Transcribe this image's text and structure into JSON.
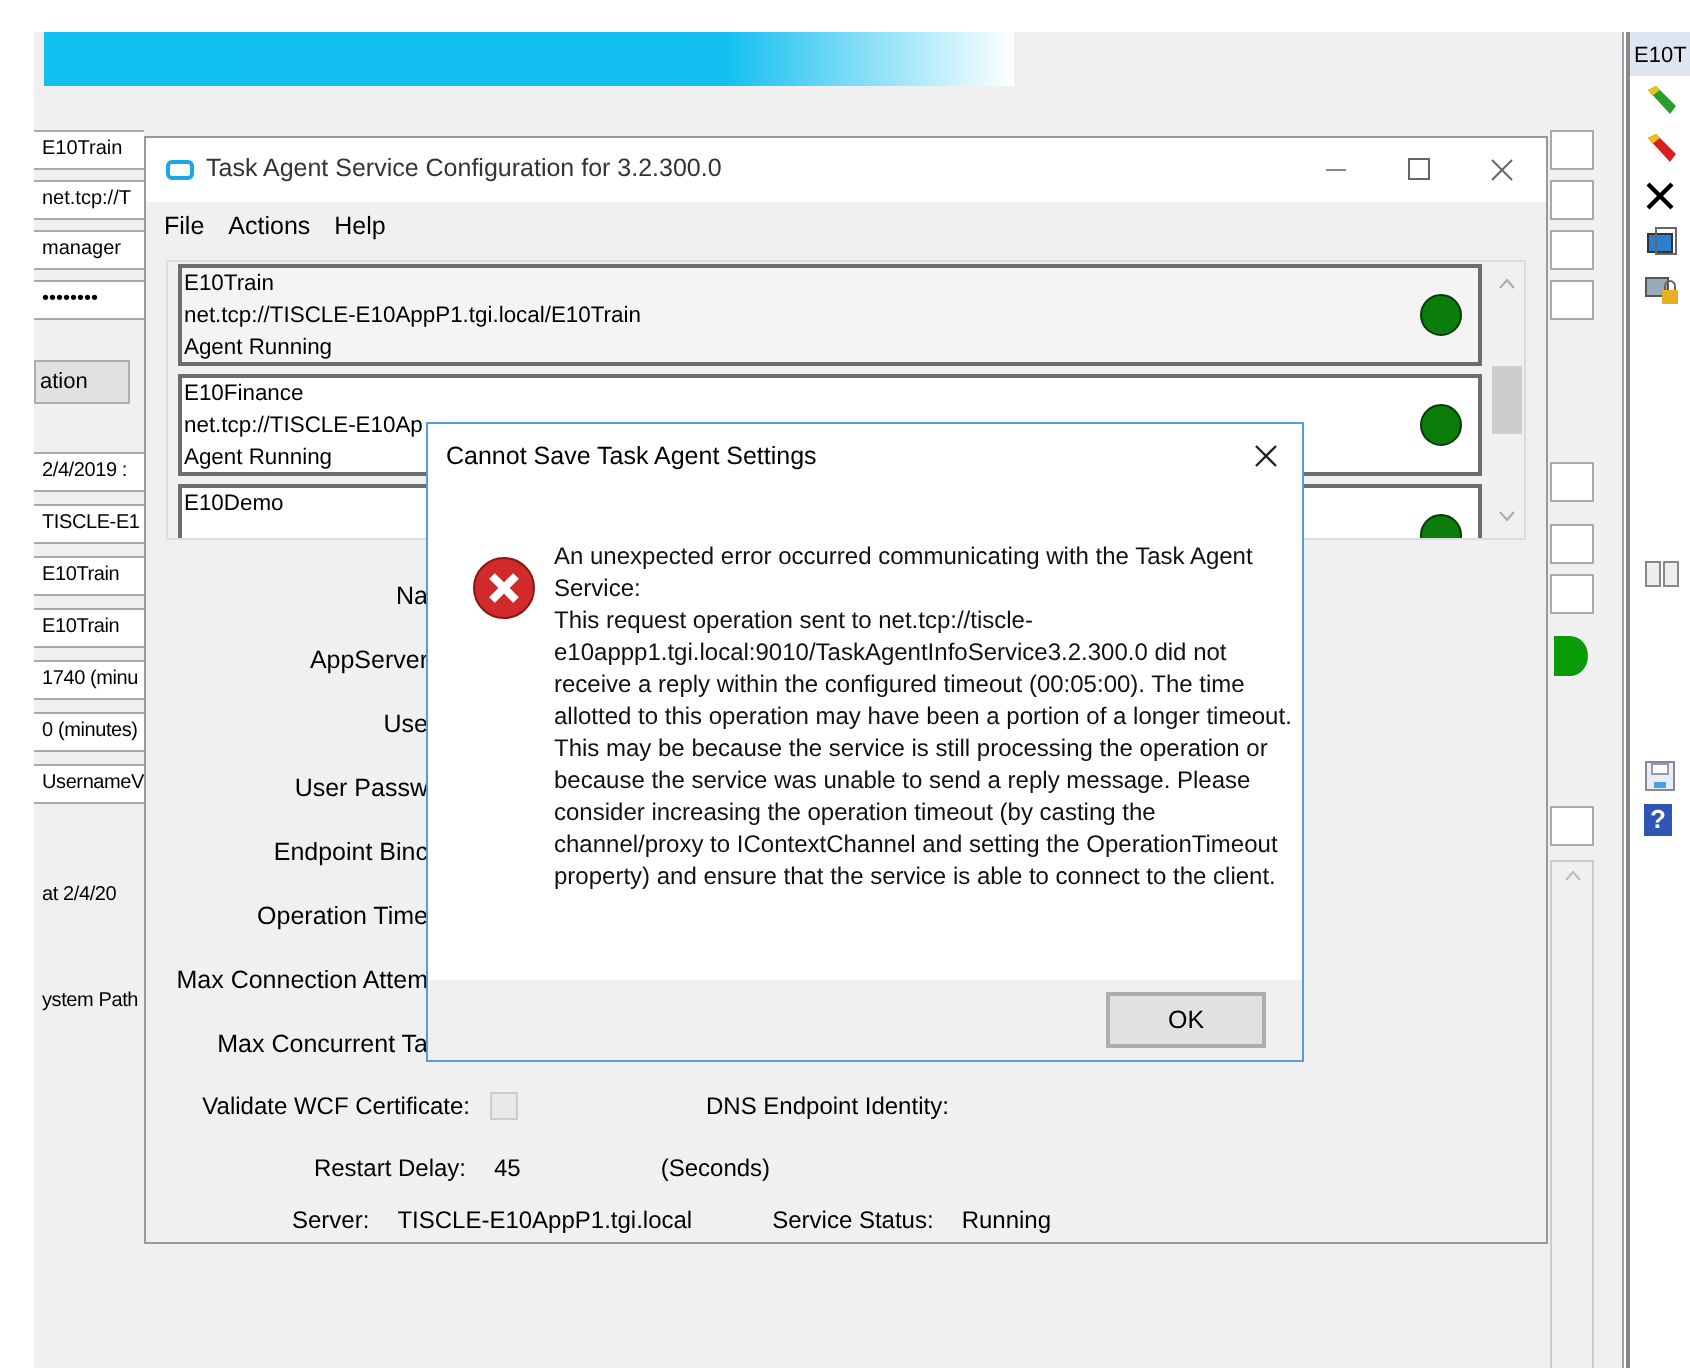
{
  "background_window": {
    "fields_top": [
      "E10Train",
      "net.tcp://T",
      "manager",
      "••••••••"
    ],
    "button": "ation",
    "fields_bottom": [
      "2/4/2019 :",
      "TISCLE-E1",
      "E10Train",
      "E10Train",
      "1740 (minu",
      "0 (minutes)",
      "UsernameV"
    ],
    "texts": [
      "at 2/4/20",
      "ystem Path"
    ]
  },
  "side_panel": {
    "header": "E10T",
    "help_glyph": "?"
  },
  "config_window": {
    "title": "Task Agent Service Configuration for 3.2.300.0",
    "menu": [
      "File",
      "Actions",
      "Help"
    ],
    "agents": [
      {
        "name": "E10Train",
        "address": "net.tcp://TISCLE-E10AppP1.tgi.local/E10Train",
        "status": "Agent Running",
        "running": true
      },
      {
        "name": "E10Finance",
        "address": "net.tcp://TISCLE-E10Ap",
        "status": "Agent Running",
        "running": true
      },
      {
        "name": "E10Demo",
        "running": true
      }
    ],
    "labels": [
      "Na",
      "AppServer",
      "Use",
      "User Passw",
      "Endpoint Binc",
      "Operation Time",
      "Max Connection Attem",
      "Max Concurrent Ta"
    ],
    "validate_wcf": {
      "label": "Validate WCF Certificate:",
      "checked": false
    },
    "dns_label": "DNS Endpoint Identity:",
    "restart_delay": {
      "label": "Restart Delay:",
      "value": "45",
      "unit": "(Seconds)"
    },
    "server": {
      "label": "Server:",
      "value": "TISCLE-E10AppP1.tgi.local"
    },
    "service_status": {
      "label": "Service Status:",
      "value": "Running"
    }
  },
  "dialog": {
    "title": "Cannot Save Task Agent Settings",
    "message": [
      "An unexpected error occurred communicating with the Task Agent Service:",
      "This request operation sent to net.tcp://tiscle-e10appp1.tgi.local:9010/TaskAgentInfoService3.2.300.0 did not receive a reply within the configured timeout (00:05:00).  The time allotted to this operation may have been a portion of a longer timeout.  This may be because the service is still processing the operation or because the service was unable to send a reply message.  Please consider increasing the operation timeout (by casting the channel/proxy to IContextChannel and setting the OperationTimeout property) and ensure that the service is able to connect to the client."
    ],
    "button": "OK"
  }
}
